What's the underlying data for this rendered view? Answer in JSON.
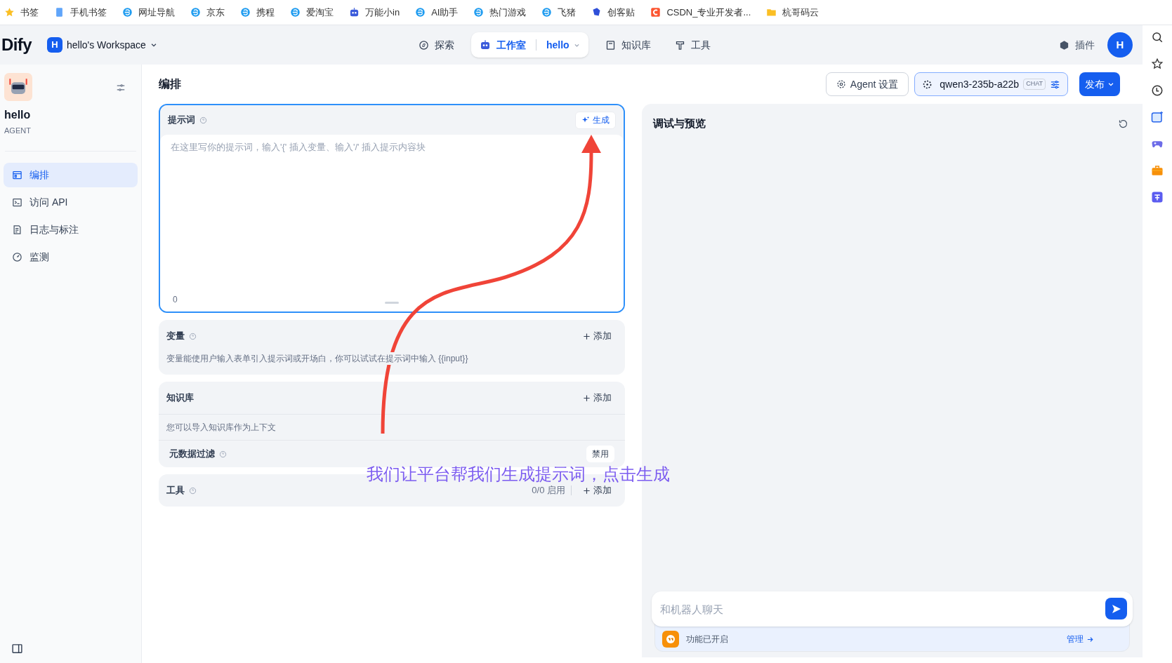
{
  "bookmarks": [
    "书签",
    "手机书签",
    "网址导航",
    "京东",
    "携程",
    "爱淘宝",
    "万能小in",
    "AI助手",
    "热门游戏",
    "飞猪",
    "创客贴",
    "CSDN_专业开发者...",
    "杭哥码云"
  ],
  "header": {
    "logo": "Dify",
    "workspace": {
      "initial": "H",
      "name": "hello's Workspace"
    },
    "nav": [
      {
        "label": "探索",
        "selected": false
      },
      {
        "label": "工作室",
        "selected": true
      },
      {
        "label": "知识库",
        "selected": false
      },
      {
        "label": "工具",
        "selected": false
      }
    ],
    "current_app": "hello",
    "plugins": "插件",
    "avatar": "H"
  },
  "sidebar": {
    "app_name": "hello",
    "app_type": "AGENT",
    "items": [
      {
        "label": "编排",
        "selected": true
      },
      {
        "label": "访问 API",
        "selected": false
      },
      {
        "label": "日志与标注",
        "selected": false
      },
      {
        "label": "监测",
        "selected": false
      }
    ]
  },
  "editor": {
    "title": "编排",
    "agent_settings": "Agent 设置",
    "model": {
      "name": "qwen3-235b-a22b",
      "mode": "CHAT"
    },
    "publish": "发布",
    "prompt": {
      "label": "提示词",
      "generate": "生成",
      "placeholder": "在这里写你的提示词，输入'{' 插入变量、输入'/' 插入提示内容块",
      "count": "0"
    },
    "variables": {
      "label": "变量",
      "add": "添加",
      "hint": "变量能使用户输入表单引入提示词或开场白，你可以试试在提示词中输入 {{input}}"
    },
    "knowledge": {
      "label": "知识库",
      "add": "添加",
      "hint": "您可以导入知识库作为上下文",
      "metadata_filter": {
        "label": "元数据过滤",
        "value": "禁用"
      }
    },
    "tools": {
      "label": "工具",
      "count": "0/0 启用",
      "add": "添加"
    }
  },
  "preview": {
    "title": "调试与预览",
    "chat_placeholder": "和机器人聊天",
    "features": "功能已开启",
    "manage": "管理"
  },
  "annotation": "我们让平台帮我们生成提示词，点击生成"
}
